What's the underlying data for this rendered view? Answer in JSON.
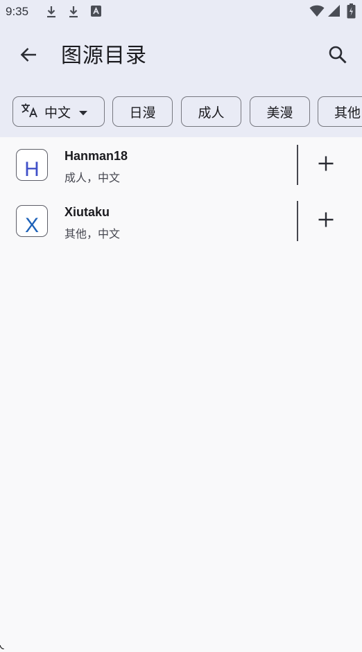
{
  "status_bar": {
    "time": "9:35",
    "left_icons": [
      "download-icon",
      "download-icon",
      "text-app-icon"
    ],
    "right_icons": [
      "wifi-icon",
      "signal-icon",
      "battery-icon"
    ]
  },
  "app_bar": {
    "title": "图源目录",
    "back_icon": "arrow-back-icon",
    "search_icon": "search-icon"
  },
  "filters": {
    "language": {
      "icon": "translate-icon",
      "label": "中文",
      "dropdown_icon": "caret-down-icon"
    },
    "chips": [
      "日漫",
      "成人",
      "美漫",
      "其他"
    ]
  },
  "sources": [
    {
      "initial": "H",
      "initial_color": "#4050c8",
      "name": "Hanman18",
      "meta": "成人，中文",
      "action_icon": "plus-icon"
    },
    {
      "initial": "X",
      "initial_color": "#1e62b8",
      "name": "Xiutaku",
      "meta": "其他，中文",
      "action_icon": "plus-icon"
    }
  ],
  "colors": {
    "top_background": "#e9ebf5",
    "page_background": "#f9f9fa",
    "outline": "#76777f"
  }
}
